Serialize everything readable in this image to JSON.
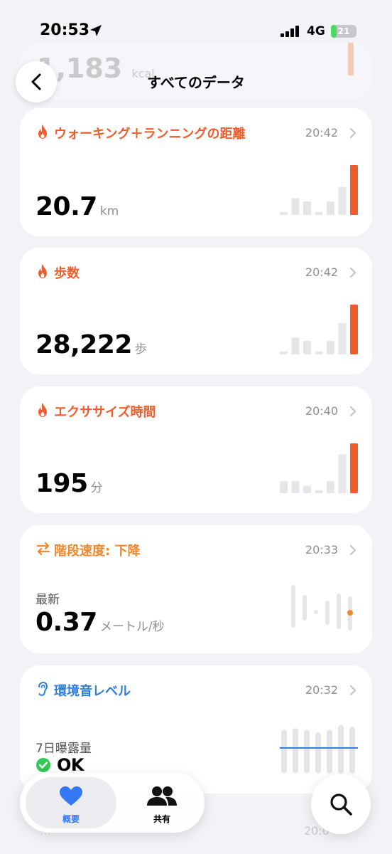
{
  "status": {
    "time": "20:53",
    "network": "4G",
    "battery": "21",
    "battery_level": 0.21
  },
  "header": {
    "title": "すべてのデータ"
  },
  "background": {
    "value": "1,183",
    "unit": "kcal",
    "bottom_title": "…",
    "bottom_time": "20:0"
  },
  "cards": [
    {
      "title": "ウォーキング＋ランニングの距離",
      "time": "20:42",
      "value": "20.7",
      "unit": "km",
      "accent": "#ee5d2b",
      "bars": [
        0.06,
        0.34,
        0.27,
        0.06,
        0.27,
        0.56,
        1.0
      ]
    },
    {
      "title": "歩数",
      "time": "20:42",
      "value": "28,222",
      "unit": "歩",
      "accent": "#ee5d2b",
      "bars": [
        0.06,
        0.34,
        0.27,
        0.06,
        0.27,
        0.63,
        1.0
      ]
    },
    {
      "title": "エクササイズ時間",
      "time": "20:40",
      "value": "195",
      "unit": "分",
      "accent": "#ee5d2b",
      "bars": [
        0.24,
        0.24,
        0.15,
        0.06,
        0.24,
        0.78,
        1.0
      ]
    },
    {
      "title": "階段速度: 下降",
      "time": "20:33",
      "sub": "最新",
      "value": "0.37",
      "unit": "メートル/秒",
      "accent": "#f0892d"
    },
    {
      "title": "環境音レベル",
      "time": "20:32",
      "sub": "7日曝露量",
      "value": "OK",
      "accent": "#2f7fd8"
    }
  ],
  "tabs": {
    "summary": "概要",
    "sharing": "共有"
  },
  "colors": {
    "accent_orange": "#ee5d2b",
    "accent_blue": "#2f7fd8",
    "tab_active": "#3478f6"
  }
}
